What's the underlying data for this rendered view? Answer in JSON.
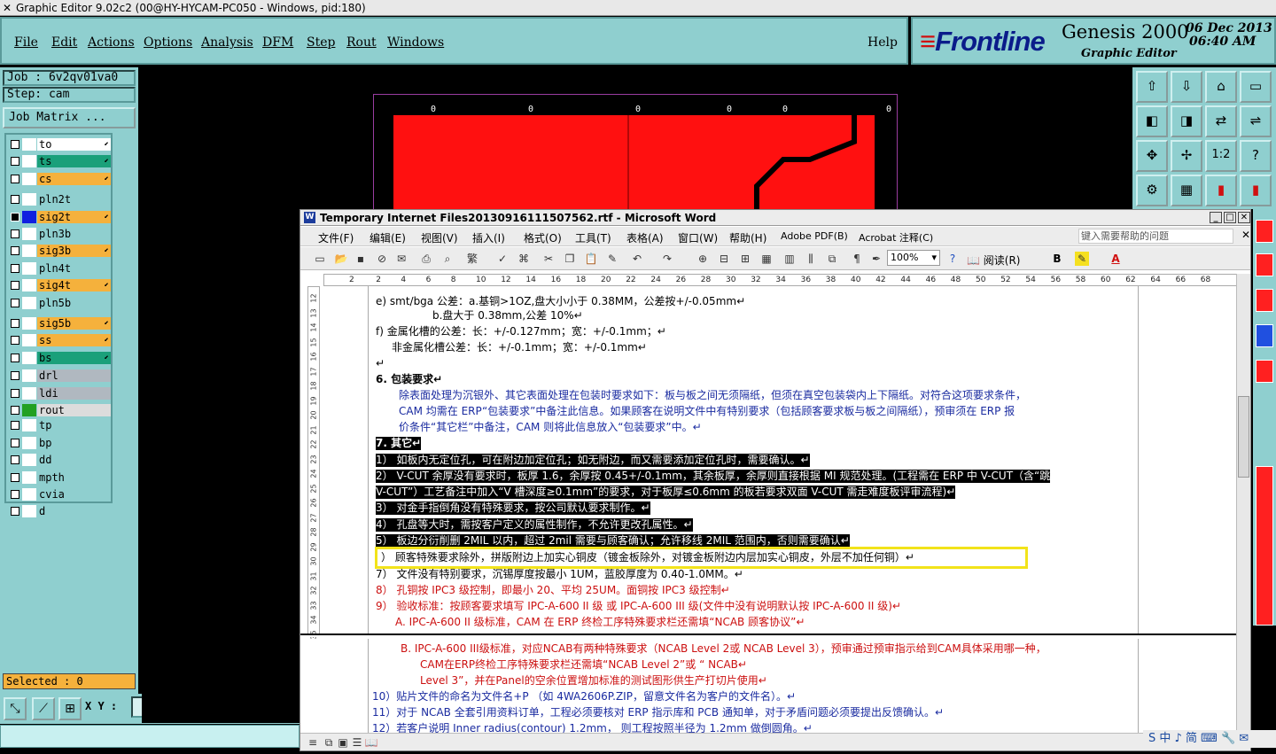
{
  "title": "Graphic Editor 9.02c2 (00@HY-HYCAM-PC050 - Windows, pid:180)",
  "menu": [
    "File",
    "Edit",
    "Actions",
    "Options",
    "Analysis",
    "DFM",
    "Step",
    "Rout",
    "Windows"
  ],
  "help": "Help",
  "logo": {
    "brand": "Frontline",
    "product": "Genesis 2000",
    "subtitle": "Graphic Editor",
    "date": "06 Dec 2013",
    "time": "06:40 AM"
  },
  "job": "Job : 6v2qv01va0",
  "step": "Step: cam",
  "job_matrix": "Job Matrix ...",
  "layers": [
    {
      "name": "to",
      "color": "#ffffff",
      "swatch": "#ffffff",
      "checked": false,
      "arrow": true
    },
    {
      "name": "ts",
      "color": "#1aa07a",
      "swatch": "#ffffff",
      "checked": false,
      "arrow": true
    },
    {
      "name": "cs",
      "color": "#f5b13c",
      "swatch": "#ffffff",
      "checked": false,
      "arrow": true
    },
    {
      "name": "pln2t",
      "color": "#8fcfcf",
      "swatch": "#ffffff",
      "checked": false,
      "arrow": false
    },
    {
      "name": "sig2t",
      "color": "#f5b13c",
      "swatch": "#1020e0",
      "checked": true,
      "arrow": true
    },
    {
      "name": "pln3b",
      "color": "#8fcfcf",
      "swatch": "#ffffff",
      "checked": false,
      "arrow": false
    },
    {
      "name": "sig3b",
      "color": "#f5b13c",
      "swatch": "#ffffff",
      "checked": false,
      "arrow": true
    },
    {
      "name": "pln4t",
      "color": "#8fcfcf",
      "swatch": "#ffffff",
      "checked": false,
      "arrow": false
    },
    {
      "name": "sig4t",
      "color": "#f5b13c",
      "swatch": "#ffffff",
      "checked": false,
      "arrow": true
    },
    {
      "name": "pln5b",
      "color": "#8fcfcf",
      "swatch": "#ffffff",
      "checked": false,
      "arrow": false
    },
    {
      "name": "sig5b",
      "color": "#f5b13c",
      "swatch": "#ffffff",
      "checked": false,
      "arrow": true
    },
    {
      "name": "ss",
      "color": "#f5b13c",
      "swatch": "#ffffff",
      "checked": false,
      "arrow": true
    },
    {
      "name": "bs",
      "color": "#1aa07a",
      "swatch": "#ffffff",
      "checked": false,
      "arrow": true
    },
    {
      "name": "drl",
      "color": "#b0b8c0",
      "swatch": "#ffffff",
      "checked": false,
      "arrow": false
    },
    {
      "name": "ldi",
      "color": "#b0b8c0",
      "swatch": "#ffffff",
      "checked": false,
      "arrow": false
    },
    {
      "name": "rout",
      "color": "#dcdcdc",
      "swatch": "#22a022",
      "checked": false,
      "arrow": false
    },
    {
      "name": "tp",
      "color": "#8fcfcf",
      "swatch": "#ffffff",
      "checked": false,
      "arrow": false
    },
    {
      "name": "bp",
      "color": "#8fcfcf",
      "swatch": "#ffffff",
      "checked": false,
      "arrow": false
    },
    {
      "name": "dd",
      "color": "#8fcfcf",
      "swatch": "#ffffff",
      "checked": false,
      "arrow": false
    },
    {
      "name": "mpth",
      "color": "#8fcfcf",
      "swatch": "#ffffff",
      "checked": false,
      "arrow": false
    },
    {
      "name": "cvia",
      "color": "#8fcfcf",
      "swatch": "#ffffff",
      "checked": false,
      "arrow": false
    },
    {
      "name": "d",
      "color": "#8fcfcf",
      "swatch": "#ffffff",
      "checked": false,
      "arrow": false
    }
  ],
  "selected": "Selected : 0",
  "xy_label": "X Y :",
  "xy_value": "",
  "board_zeros": [
    "0",
    "0",
    "0",
    "0",
    "0",
    "0"
  ],
  "word": {
    "title": "Temporary Internet Files20130916111507562.rtf - Microsoft Word",
    "menu": [
      "文件(F)",
      "编辑(E)",
      "视图(V)",
      "插入(I)",
      "格式(O)",
      "工具(T)",
      "表格(A)",
      "窗口(W)",
      "帮助(H)",
      "Adobe PDF(B)",
      "Acrobat 注释(C)"
    ],
    "help_placeholder": "键入需要帮助的问题",
    "zoom": "100%",
    "reading": "阅读(R)",
    "ruler_numbers": [
      "2",
      "2",
      "4",
      "6",
      "8",
      "10",
      "12",
      "14",
      "16",
      "18",
      "20",
      "22",
      "24",
      "26",
      "28",
      "30",
      "32",
      "34",
      "36",
      "38",
      "40",
      "42",
      "44",
      "46",
      "48",
      "50",
      "52",
      "54",
      "56",
      "58",
      "60",
      "62",
      "64",
      "66",
      "68"
    ],
    "vruler_numbers": [
      "12",
      "13",
      "14",
      "15",
      "16",
      "17",
      "18",
      "19",
      "20",
      "21",
      "22",
      "23",
      "24",
      "25",
      "26",
      "27",
      "28",
      "29",
      "30",
      "31",
      "32",
      "33",
      "34",
      "35"
    ],
    "lines": [
      "e) smt/bga 公差：a.基铜>1OZ,盘大小小于 0.38MM，公差按+/-0.05mm↵",
      "b.盘大于 0.38mm,公差 10%↵",
      "f) 金属化槽的公差：长：+/-0.127mm；宽：+/-0.1mm；↵",
      "非金属化槽公差：长：+/-0.1mm；宽：+/-0.1mm↵",
      "↵",
      "6. 包装要求↵",
      "除表面处理为沉银外、其它表面处理在包装时要求如下：板与板之间无须隔纸，但须在真空包装袋内上下隔纸。对符合这项要求条件，",
      "CAM 均需在 ERP“包装要求”中备注此信息。如果顾客在说明文件中有特别要求（包括顾客要求板与板之间隔纸），预审须在 ERP 报",
      "价条件“其它栏”中备注，CAM 则将此信息放入“包装要求”中。↵",
      "7. 其它↵",
      "1） 如板内无定位孔，可在附边加定位孔；如无附边，而又需要添加定位孔时，需要确认。↵",
      "2） V-CUT 余厚没有要求时，板厚 1.6，余厚按 0.45+/-0.1mm，其余板厚，余厚则直接根据 MI 规范处理。(工程需在 ERP 中 V-CUT（含“跳",
      "V-CUT”）工艺备注中加入“V 槽深度≥0.1mm”的要求，对于板厚≤0.6mm 的板若要求双面 V-CUT 需走难度板评审流程)↵",
      "3） 对金手指倒角没有特殊要求，按公司默认要求制作。↵",
      "4） 孔盘等大时，需按客户定义的属性制作，不允许更改孔属性。↵",
      "5） 板边分衍削删 2MIL 以内，超过 2mil 需要与顾客确认；允许移线 2MIL 范围内，否则需要确认↵",
      "） 顾客特殊要求除外，拼版附边上加实心铜皮（镀金板除外，对镀金板附边内层加实心铜皮，外层不加任何铜）↵",
      "7） 文件没有特别要求，沉锡厚度按最小 1UM，蓝胶厚度为 0.40-1.0MM。↵",
      "8） 孔铜按 IPC3 级控制，即最小 20、平均 25UM。面铜按 IPC3 级控制↵",
      "9） 验收标准：按顾客要求填写 IPC-A-600 II 级 或 IPC-A-600 III 级(文件中没有说明默认按 IPC-A-600 II 级)↵",
      "A. IPC-A-600 II 级标准，CAM 在 ERP 终检工序特殊要求栏还需填“NCAB 顾客协议”↵",
      "B. IPC-A-600 III级标准，对应NCAB有两种特殊要求（NCAB Level 2或 NCAB Level 3），预审通过预审指示给到CAM具体采用哪一种，",
      "CAM在ERP终检工序特殊要求栏还需填“NCAB Level 2”或 “ NCAB↵",
      "Level 3”，并在Panel的空余位置增加标准的测试图形供生产打切片使用↵",
      "10）贴片文件的命名为文件名+P （如 4WA2606P.ZIP，留意文件名为客户的文件名）。↵",
      "11）对于 NCAB 全套引用资料订单，工程必须要核对 ERP 指示库和 PCB 通知单，对于矛盾问题必须要提出反馈确认。↵",
      "12）若客户说明 Inner radius(contour) 1.2mm， 则工程按照半径为 1.2mm 做倒圆角。↵"
    ]
  },
  "tray": "S 中 ♪ 简 ⌨ 🔧 ✉"
}
